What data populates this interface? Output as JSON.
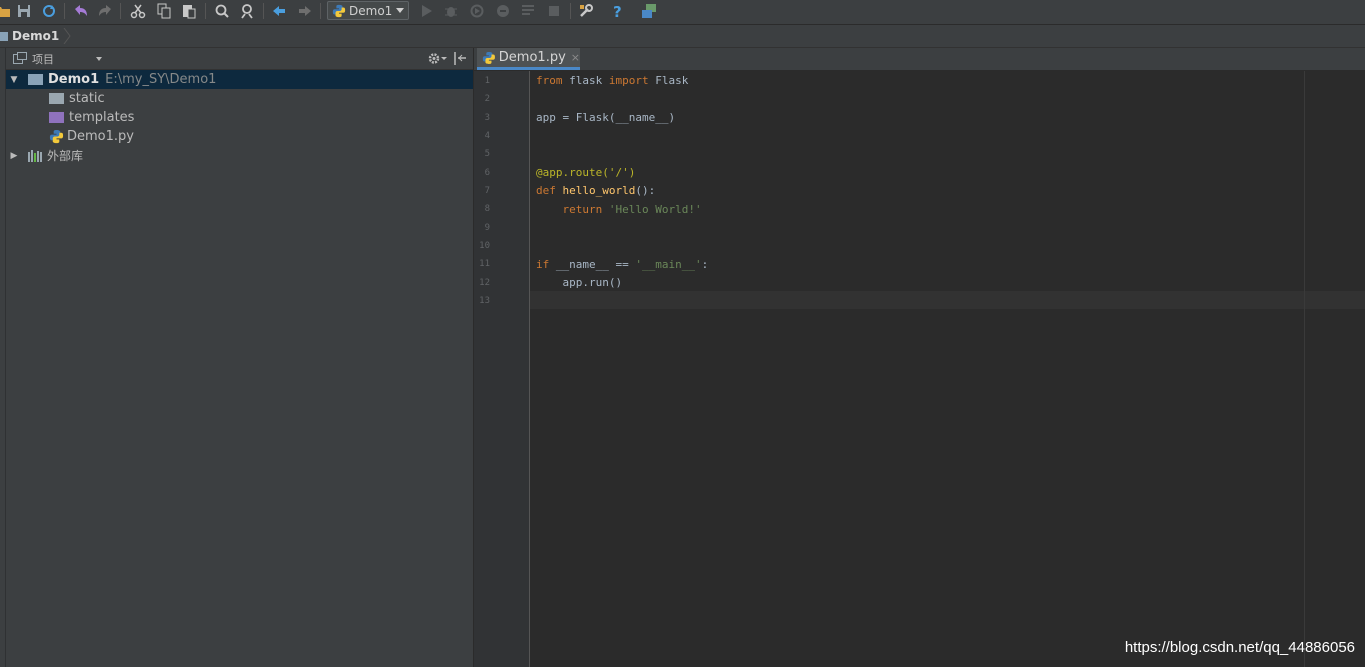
{
  "toolbar": {
    "run_config_label": "Demo1"
  },
  "breadcrumb": {
    "label": "Demo1"
  },
  "project_panel": {
    "title": "项目",
    "tree": [
      {
        "label": "Demo1",
        "path": "E:\\my_SY\\Demo1",
        "type": "project-root",
        "expanded": true,
        "selected": true
      },
      {
        "label": "static",
        "type": "folder"
      },
      {
        "label": "templates",
        "type": "folder"
      },
      {
        "label": "Demo1.py",
        "type": "python-file"
      },
      {
        "label": "外部库",
        "type": "external-libraries",
        "expanded": false
      }
    ]
  },
  "editor": {
    "tab_label": "Demo1.py",
    "tab_close": "×",
    "line_numbers": [
      "1",
      "2",
      "3",
      "4",
      "5",
      "6",
      "7",
      "8",
      "9",
      "10",
      "11",
      "12",
      "13"
    ],
    "code": {
      "l1_from": "from",
      "l1_mod": " flask ",
      "l1_import": "import",
      "l1_name": " Flask",
      "l3": "app = Flask(__name__)",
      "l6": "@app.route('/')",
      "l7_def": "def",
      "l7_fn": " hello_world",
      "l7_rest": "():",
      "l8_indent": "    ",
      "l8_return": "return",
      "l8_space": " ",
      "l8_str": "'Hello World!'",
      "l11_if": "if",
      "l11_mid": " __name__ == ",
      "l11_str": "'__main__'",
      "l11_end": ":",
      "l12": "    app.run()"
    }
  },
  "watermark": "https://blog.csdn.net/qq_44886056",
  "colors": {
    "background": "#3c3f41",
    "editor_background": "#2b2b2b",
    "keyword": "#cc7832",
    "string": "#6a8759",
    "decorator": "#bbb529",
    "selection": "#0d293e",
    "tab_accent": "#4a88c7"
  },
  "icons": {
    "toolbar": [
      "open-icon",
      "save-icon",
      "sync-icon",
      "undo-icon",
      "redo-icon",
      "cut-icon",
      "copy-icon",
      "paste-icon",
      "find-icon",
      "replace-icon",
      "back-icon",
      "forward-icon",
      "python-icon",
      "run-icon",
      "debug-icon",
      "coverage-icon",
      "profile-icon",
      "build-icon",
      "stop-icon",
      "settings-icon",
      "help-icon",
      "python-console-icon"
    ]
  }
}
